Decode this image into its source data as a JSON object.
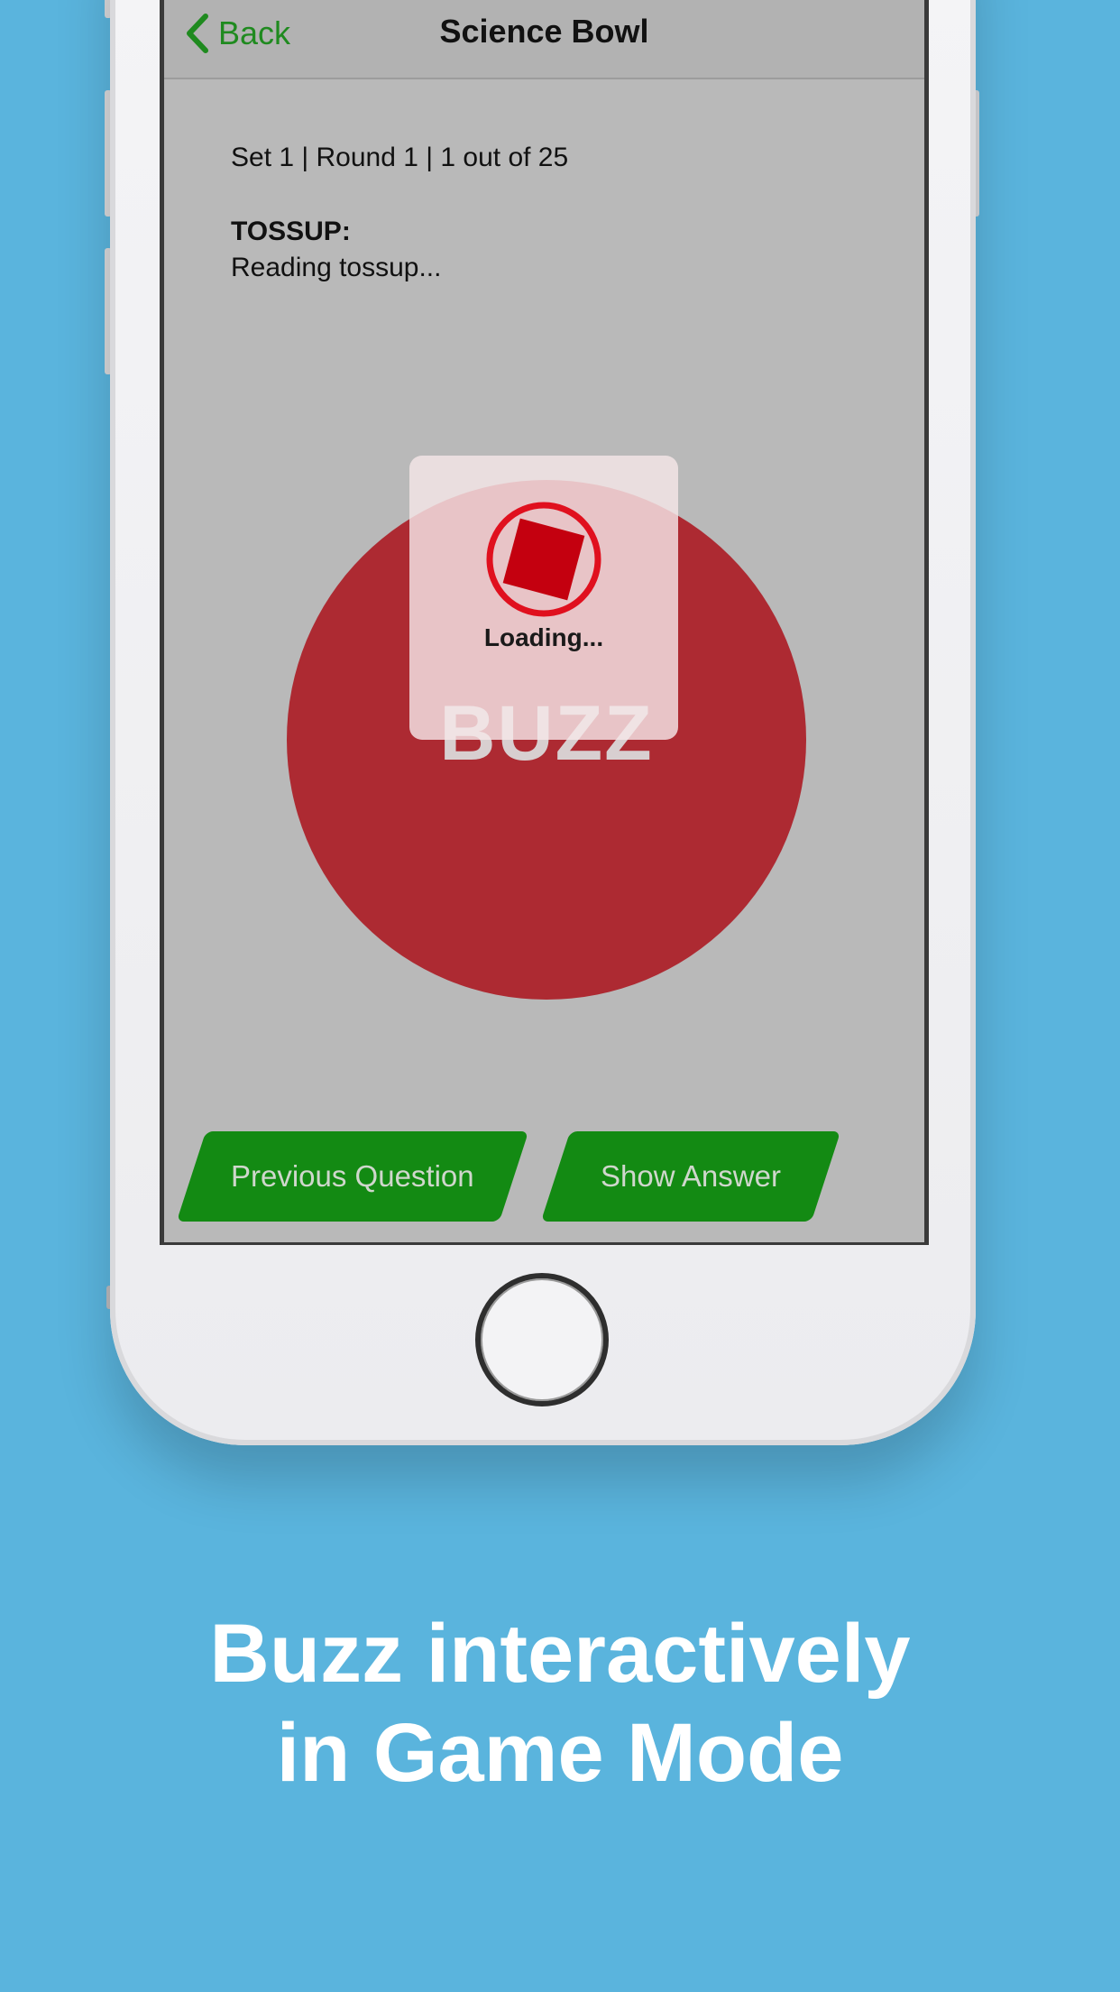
{
  "nav": {
    "back_label": "Back",
    "title": "Science Bowl"
  },
  "question": {
    "meta": "Set 1 | Round 1 | 1 out of 25",
    "type_label": "TOSSUP:",
    "text": "Reading tossup..."
  },
  "buzzer": {
    "label": "BUZZ",
    "color": "#ad2a32"
  },
  "loading": {
    "text": "Loading..."
  },
  "buttons": {
    "previous_label": "Previous Question",
    "show_answer_label": "Show Answer",
    "color": "#138a13"
  },
  "caption": {
    "line1": "Buzz interactively",
    "line2": "in Game Mode"
  },
  "colors": {
    "background": "#5ab4dd",
    "accent_green": "#1f8a1f"
  },
  "icons": [
    "chevron-left-icon",
    "loading-spinner-icon",
    "home-button"
  ]
}
